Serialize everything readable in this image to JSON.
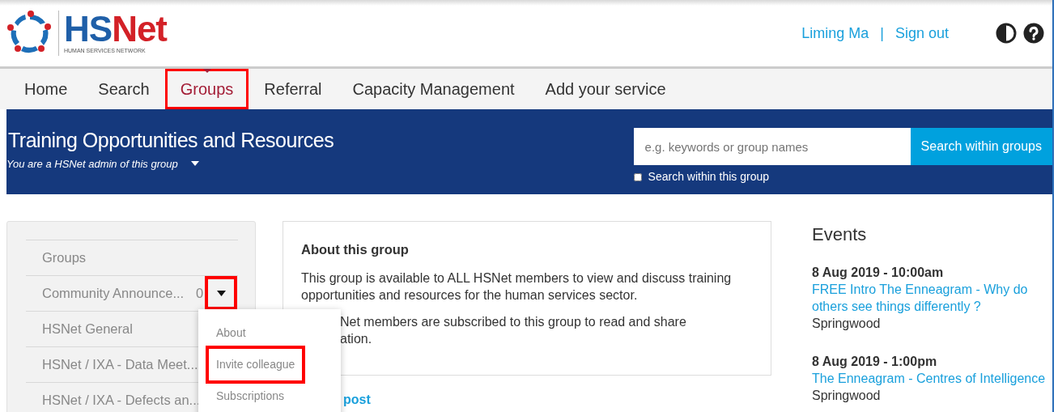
{
  "header": {
    "logo": {
      "name": "HSNet",
      "tagline": "HUMAN SERVICES NETWORK"
    },
    "user_links": [
      {
        "label": "Liming Ma"
      },
      {
        "label": "Sign out"
      }
    ],
    "separator": "|"
  },
  "nav": [
    {
      "label": "Home",
      "selected": false,
      "highlighted": false
    },
    {
      "label": "Search",
      "selected": false,
      "highlighted": false
    },
    {
      "label": "Groups",
      "selected": true,
      "highlighted": true
    },
    {
      "label": "Referral",
      "selected": false,
      "highlighted": false
    },
    {
      "label": "Capacity Management",
      "selected": false,
      "highlighted": false
    },
    {
      "label": "Add your service",
      "selected": false,
      "highlighted": false
    }
  ],
  "banner": {
    "title": "Training Opportunities and Resources",
    "subtitle": "You are a HSNet admin of this group",
    "search": {
      "placeholder": "e.g. keywords or group names",
      "button": "Search within groups",
      "option": {
        "label": "Search within this group",
        "checked": false
      }
    }
  },
  "sidebar": {
    "heading": "Groups",
    "items": [
      {
        "label": "Community Announce...",
        "count": "0",
        "toggle_highlighted": true
      },
      {
        "label": "HSNet General"
      },
      {
        "label": "HSNet / IXA - Data Meet..."
      },
      {
        "label": "HSNet / IXA - Defects an..."
      }
    ]
  },
  "dropdown": {
    "items": [
      {
        "label": "About",
        "highlighted": false
      },
      {
        "label": "Invite colleague",
        "highlighted": true
      },
      {
        "label": "Subscriptions",
        "highlighted": false
      }
    ]
  },
  "about": {
    "title": "About this group",
    "paragraph": "This group is available to ALL HSNet members to view and discuss training opportunities and resources for the human services sector.",
    "partial_lines": [
      "Net members are subscribed to this group to read and share",
      "ation."
    ]
  },
  "post_link": "post",
  "events": {
    "title": "Events",
    "items": [
      {
        "when": "8 Aug 2019 - 10:00am",
        "title": "FREE Intro The Enneagram - Why do others see things differently ?",
        "place": "Springwood"
      },
      {
        "when": "8 Aug 2019 - 1:00pm",
        "title": "The Enneagram - Centres of Intelligence",
        "place": "Springwood"
      }
    ]
  }
}
